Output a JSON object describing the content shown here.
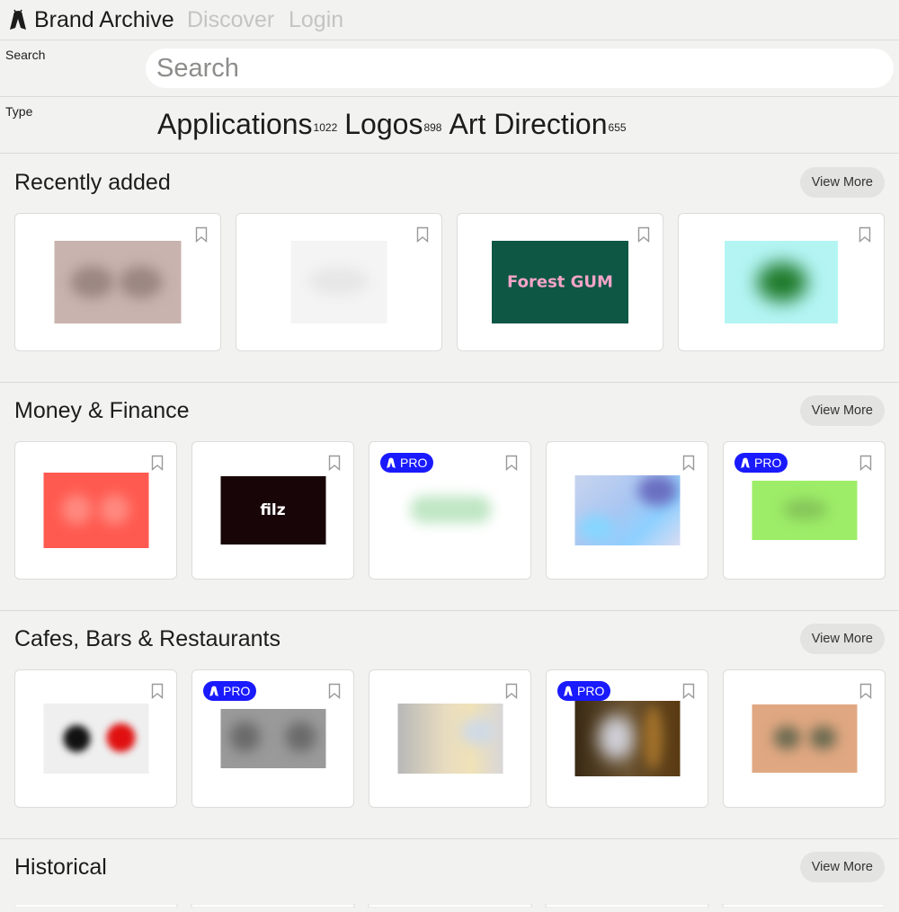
{
  "nav": {
    "brand": "Brand Archive",
    "links": [
      "Discover",
      "Login"
    ]
  },
  "search": {
    "label": "Search",
    "placeholder": "Search"
  },
  "type_filter": {
    "label": "Type",
    "options": [
      {
        "name": "Applications",
        "count": "1022"
      },
      {
        "name": "Logos",
        "count": "898"
      },
      {
        "name": "Art Direction",
        "count": "655"
      }
    ]
  },
  "colors": {
    "background": "#f2f2f0",
    "pro_badge": "#1a1aff",
    "nav_link_inactive": "#c4c4c2"
  },
  "view_more_label": "View More",
  "pro_label": "PRO",
  "sections": [
    {
      "title": "Recently added",
      "cards": [
        {
          "pro": false,
          "thumb_text": ""
        },
        {
          "pro": false,
          "thumb_text": ""
        },
        {
          "pro": false,
          "thumb_text": "Forest GUM"
        },
        {
          "pro": false,
          "thumb_text": ""
        }
      ]
    },
    {
      "title": "Money & Finance",
      "cards": [
        {
          "pro": false,
          "thumb_text": ""
        },
        {
          "pro": false,
          "thumb_text": "filz"
        },
        {
          "pro": true,
          "thumb_text": ""
        },
        {
          "pro": false,
          "thumb_text": ""
        },
        {
          "pro": true,
          "thumb_text": ""
        }
      ]
    },
    {
      "title": "Cafes, Bars & Restaurants",
      "cards": [
        {
          "pro": false,
          "thumb_text": ""
        },
        {
          "pro": true,
          "thumb_text": ""
        },
        {
          "pro": false,
          "thumb_text": ""
        },
        {
          "pro": true,
          "thumb_text": ""
        },
        {
          "pro": false,
          "thumb_text": ""
        }
      ]
    },
    {
      "title": "Historical",
      "cards": []
    }
  ]
}
